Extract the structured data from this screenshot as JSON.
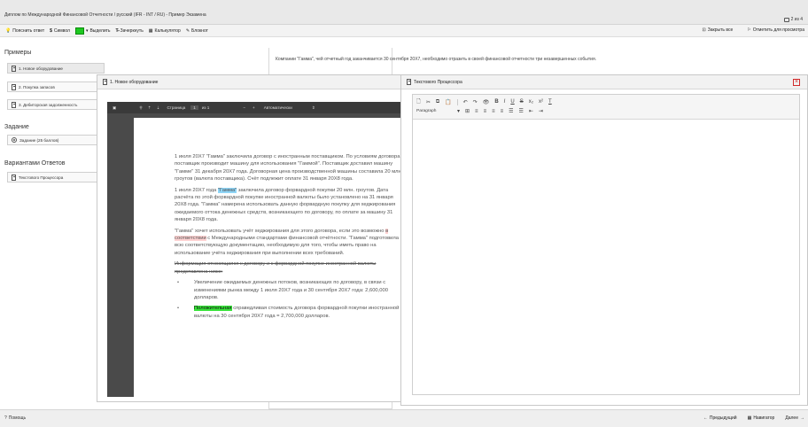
{
  "title": "Диплом по Международной Финансовой Отчетности / русский (IFR - INT / RU) - Пример Экзамена",
  "pager": "2 из 4",
  "toolbar": {
    "explain": "Пояснить ответ",
    "symbol": "Символ",
    "highlight": "Выделить",
    "strike": "Зачеркнуть",
    "calculator": "Калькулятор",
    "notepad": "Блокнот",
    "close_all": "Закрыть все",
    "mark_review": "Отметить для просмотра"
  },
  "left": {
    "examples_title": "Примеры",
    "examples": [
      "1. Новое оборудование",
      "2. Покупка запасов",
      "3. Дебиторская задолженность"
    ],
    "task_title": "Задание",
    "task_item": "Задание (25 баллов)",
    "answers_title": "Вариантами Ответов",
    "answer_item": "Текстового Процессора"
  },
  "main_text": "Компании \"Гамма\", чей отчетный год заканчивается 30 сентября 20X7, необходимо отразить в своей финансовой отчетности три незавершенных события.",
  "pdf": {
    "window_title": "1. Новое оборудование",
    "page_label": "Страница",
    "page_num": "1",
    "page_of": "из 1",
    "zoom": "Автоматически",
    "p1": "1 июля 20X7 \"Гамма\" заключила договор с иностранным поставщиком. По условиям договора поставщик производит машину для использования \"Гаммой\". Поставщик доставил машину \"Гамме\" 31 декабря 20X7 года. Договорная цена производственной машины составила 20 млн. гроутов (валюта поставщика). Счёт подлежит оплате 31 января 20X8 года.",
    "p2_a": "1 июля 20X7 года ",
    "p2_hl": "\"Гамма\"",
    "p2_b": " заключила договор форвардной покупки 20 млн. гроутов. Дата расчёта по этой форвардной покупке иностранной валюты было установлено на 31 января 20X8 года. \"Гамма\" намерена использовать данную форвардную покупку для хеджирования ожидаемого оттока денежных средств, возникающего по договору, по оплате за машину 31 января 20X8 года.",
    "p3_a": "\"Гамма\" хочет использовать учёт хеджирования для этого договора, если это возможно ",
    "p3_hl": "в соответствии",
    "p3_b": " с Международными стандартами финансовой отчётности. \"Гамма\" подготовила всю соответствующую документацию, необходимую для того, чтобы иметь право на использование учёта хеджирования при выполнении всех требований.",
    "p4": "Информация относящаяся к договору и к форвардной покупке иностранной валюты представлена ниже:",
    "b1": "Увеличение ожидаемых денежных потоков, возникающих по договору, в связи с изменениями рынка между 1 июля 20X7 года и 30 сентября 20X7 года: 2,600,000 долларов.",
    "b2_hl": "Положительная",
    "b2_b": " справедливая стоимость договора форвардной покупки иностранной валюты на 30 сентября 20X7 года = 2,700,000 долларов."
  },
  "wp": {
    "window_title": "Текстового Процессора",
    "paragraph": "Paragraph"
  },
  "bottom": {
    "help": "Помощь",
    "prev": "Предыдущий",
    "navigator": "Навигатор",
    "next": "Далее"
  }
}
